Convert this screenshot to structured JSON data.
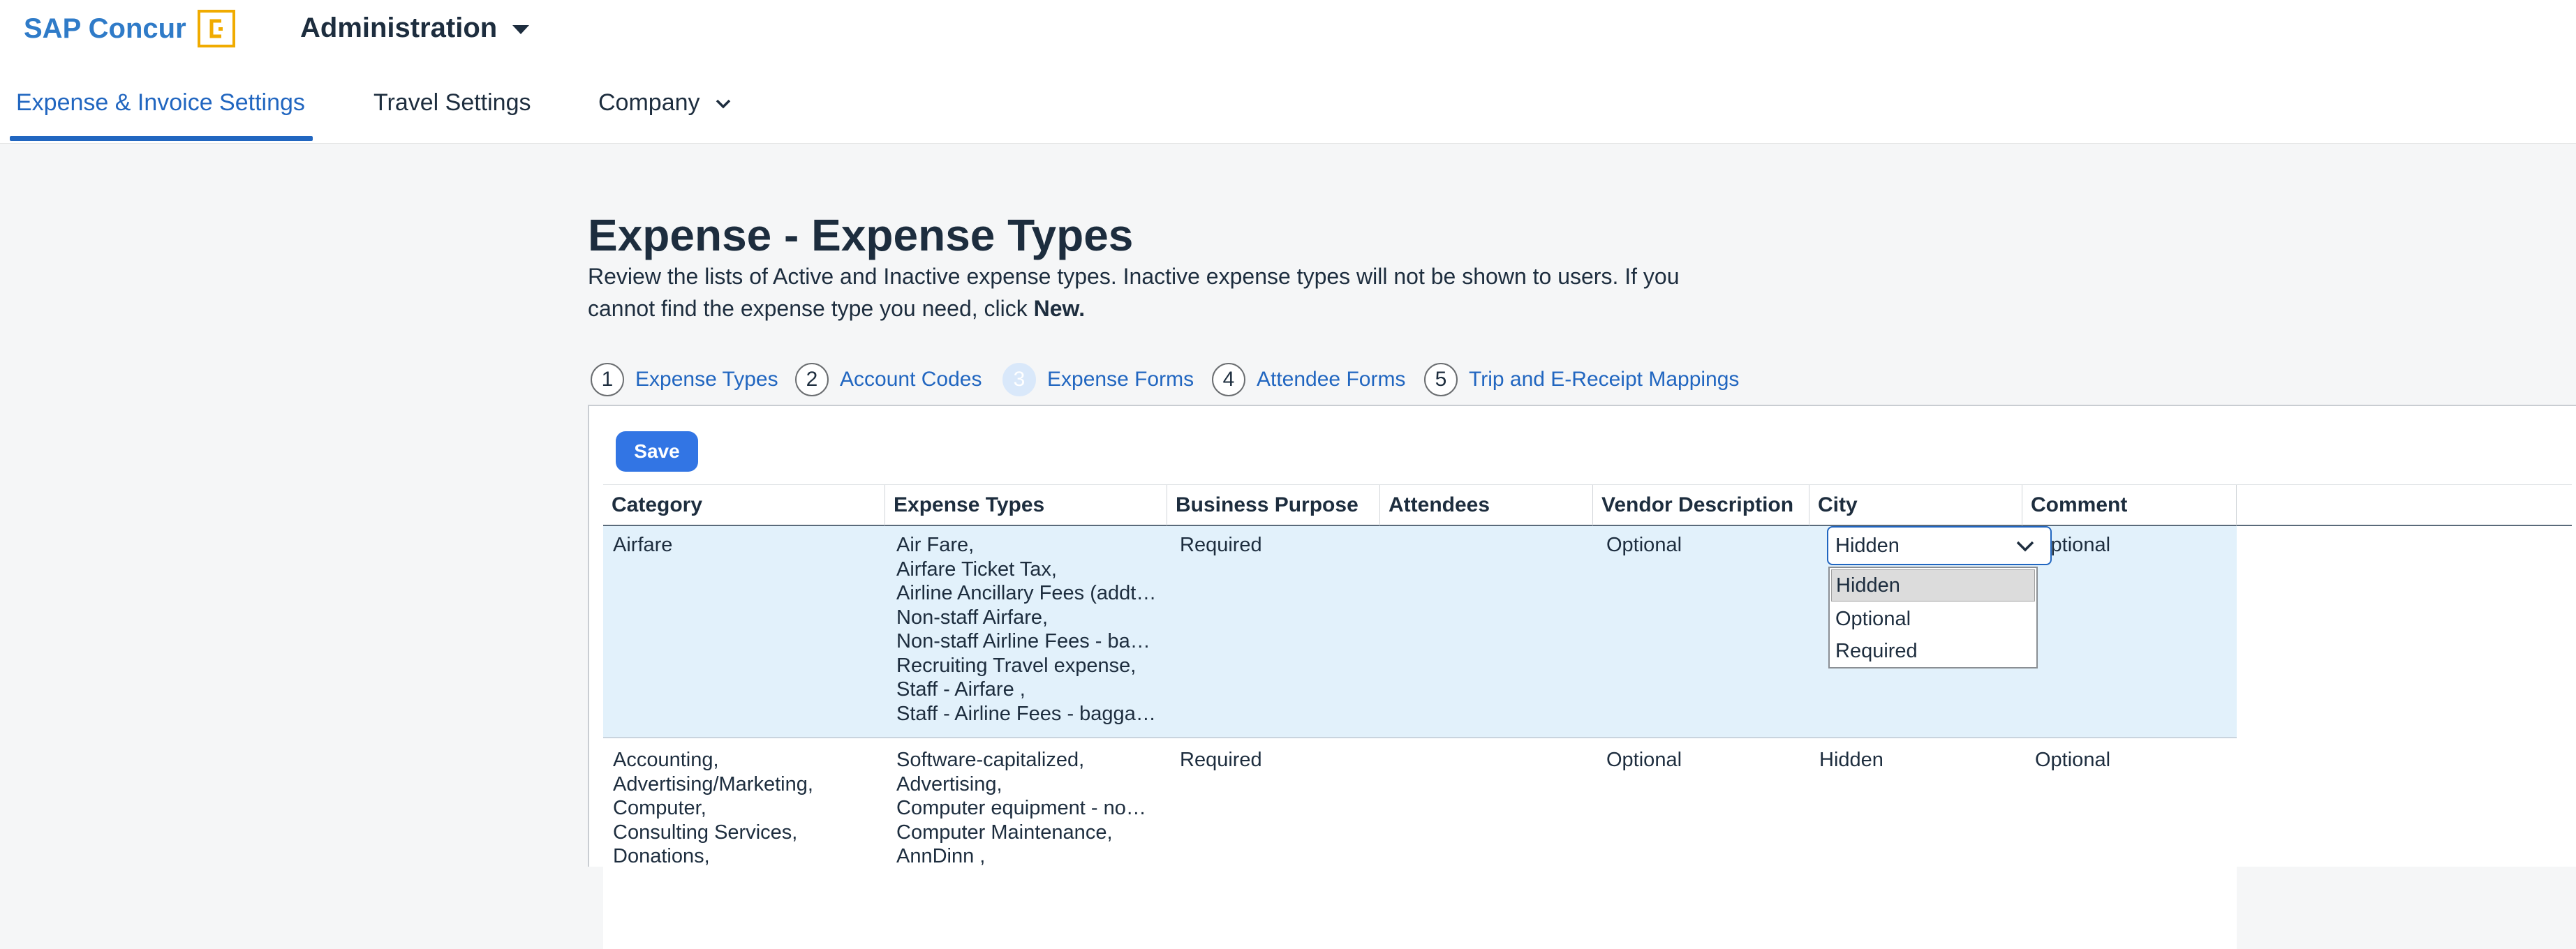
{
  "header": {
    "brand": "SAP Concur",
    "admin_label": "Administration"
  },
  "nav": {
    "items": [
      {
        "label": "Expense & Invoice Settings",
        "active": true
      },
      {
        "label": "Travel Settings",
        "active": false
      },
      {
        "label": "Company",
        "active": false
      }
    ]
  },
  "page": {
    "title": "Expense - Expense Types",
    "description": "Review the lists of Active and Inactive expense types. Inactive expense types will not be shown to users. If you cannot find the expense type you need, click",
    "description_bold": "New."
  },
  "steps": [
    {
      "num": "1",
      "label": "Expense Types"
    },
    {
      "num": "2",
      "label": "Account Codes"
    },
    {
      "num": "3",
      "label": "Expense Forms",
      "current": true
    },
    {
      "num": "4",
      "label": "Attendee Forms"
    },
    {
      "num": "5",
      "label": "Trip and E-Receipt Mappings"
    }
  ],
  "toolbar": {
    "save_label": "Save"
  },
  "table": {
    "columns": [
      "Category",
      "Expense Types",
      "Business Purpose",
      "Attendees",
      "Vendor Description",
      "City",
      "Comment"
    ],
    "rows": [
      {
        "category": [
          "Airfare"
        ],
        "expense_types": [
          "Air Fare,",
          "Airfare Ticket Tax,",
          "Airline Ancillary Fees (addt…",
          "Non-staff Airfare,",
          "Non-staff Airline Fees - ba…",
          "Recruiting Travel expense,",
          "Staff - Airfare ,",
          "Staff - Airline Fees - bagga…"
        ],
        "business_purpose": "Required",
        "attendees": "",
        "vendor_description": "Optional",
        "city": "Hidden",
        "comment": "Optional"
      },
      {
        "category": [
          "Accounting,",
          "Advertising/Marketing,",
          "Computer,",
          "Consulting Services,",
          "Donations,"
        ],
        "expense_types": [
          "Software-capitalized,",
          "Advertising,",
          "Computer equipment - no…",
          "Computer Maintenance,",
          "AnnDinn ,"
        ],
        "business_purpose": "Required",
        "attendees": "",
        "vendor_description": "Optional",
        "city": "Hidden",
        "comment": "Optional"
      }
    ]
  },
  "city_dropdown": {
    "selected": "Hidden",
    "options": [
      "Hidden",
      "Optional",
      "Required"
    ]
  },
  "colors": {
    "brand_blue": "#2f7bc8",
    "logo_orange": "#f0ab00",
    "link_blue": "#2166c0",
    "save_button": "#3275e4",
    "selected_row": "#e2f1fb"
  },
  "icons": [
    "concur-logo-icon",
    "caret-down-icon",
    "chevron-down-icon"
  ]
}
